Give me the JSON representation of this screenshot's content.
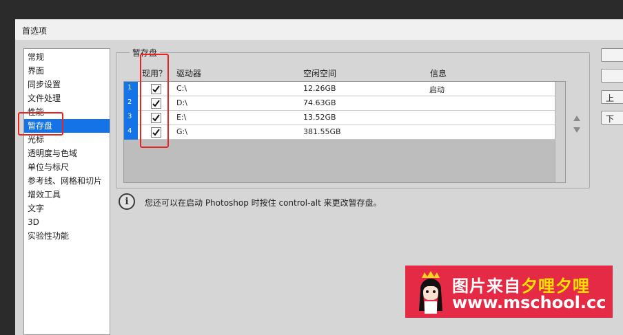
{
  "dialog": {
    "title": "首选项"
  },
  "sidebar": {
    "items": [
      {
        "label": "常规"
      },
      {
        "label": "界面"
      },
      {
        "label": "同步设置"
      },
      {
        "label": "文件处理"
      },
      {
        "label": "性能"
      },
      {
        "label": "暂存盘",
        "selected": true
      },
      {
        "label": "光标"
      },
      {
        "label": "透明度与色域"
      },
      {
        "label": "单位与标尺"
      },
      {
        "label": "参考线、网格和切片"
      },
      {
        "label": "增效工具"
      },
      {
        "label": "文字"
      },
      {
        "label": "3D"
      },
      {
        "label": "实验性功能"
      }
    ]
  },
  "scratch": {
    "group_title": "暂存盘",
    "headers": {
      "active": "现用？",
      "drive": "驱动器",
      "free": "空闲空间",
      "info": "信息"
    },
    "rows": [
      {
        "num": "1",
        "checked": true,
        "drive": "C:\\",
        "free": "12.26GB",
        "info": "启动"
      },
      {
        "num": "2",
        "checked": true,
        "drive": "D:\\",
        "free": "74.63GB",
        "info": ""
      },
      {
        "num": "3",
        "checked": true,
        "drive": "E:\\",
        "free": "13.52GB",
        "info": ""
      },
      {
        "num": "4",
        "checked": true,
        "drive": "G:\\",
        "free": "381.55GB",
        "info": ""
      }
    ],
    "hint": "您还可以在启动 Photoshop 时按住 control-alt 来更改暂存盘。"
  },
  "buttons": {
    "btn1": "",
    "btn2": "",
    "btn3": "上",
    "btn4": "下"
  },
  "watermark": {
    "line1_prefix": "图片来自",
    "line1_highlight": "夕哩夕哩",
    "line2": "www.mschool.cc"
  },
  "colors": {
    "selection": "#1473e6",
    "highlight_box": "#e8251f",
    "watermark_bg": "#e42a44",
    "watermark_accent": "#ffe100"
  },
  "icons": {
    "info": "info-icon",
    "checkmark": "checkmark-icon",
    "move_up": "arrow-up-icon",
    "move_down": "arrow-down-icon"
  }
}
